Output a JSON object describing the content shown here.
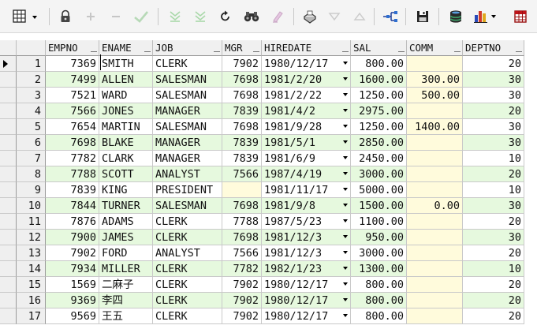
{
  "columns": [
    "EMPNO",
    "ENAME",
    "JOB",
    "MGR",
    "HIREDATE",
    "SAL",
    "COMM",
    "DEPTNO"
  ],
  "rows": [
    {
      "num": "1",
      "empno": "7369",
      "ename": "SMITH",
      "job": "CLERK",
      "mgr": "7902",
      "hiredate": "1980/12/17",
      "sal": "800.00",
      "comm": "",
      "deptno": "20"
    },
    {
      "num": "2",
      "empno": "7499",
      "ename": "ALLEN",
      "job": "SALESMAN",
      "mgr": "7698",
      "hiredate": "1981/2/20",
      "sal": "1600.00",
      "comm": "300.00",
      "deptno": "30"
    },
    {
      "num": "3",
      "empno": "7521",
      "ename": "WARD",
      "job": "SALESMAN",
      "mgr": "7698",
      "hiredate": "1981/2/22",
      "sal": "1250.00",
      "comm": "500.00",
      "deptno": "30"
    },
    {
      "num": "4",
      "empno": "7566",
      "ename": "JONES",
      "job": "MANAGER",
      "mgr": "7839",
      "hiredate": "1981/4/2",
      "sal": "2975.00",
      "comm": "",
      "deptno": "20"
    },
    {
      "num": "5",
      "empno": "7654",
      "ename": "MARTIN",
      "job": "SALESMAN",
      "mgr": "7698",
      "hiredate": "1981/9/28",
      "sal": "1250.00",
      "comm": "1400.00",
      "deptno": "30"
    },
    {
      "num": "6",
      "empno": "7698",
      "ename": "BLAKE",
      "job": "MANAGER",
      "mgr": "7839",
      "hiredate": "1981/5/1",
      "sal": "2850.00",
      "comm": "",
      "deptno": "30"
    },
    {
      "num": "7",
      "empno": "7782",
      "ename": "CLARK",
      "job": "MANAGER",
      "mgr": "7839",
      "hiredate": "1981/6/9",
      "sal": "2450.00",
      "comm": "",
      "deptno": "10"
    },
    {
      "num": "8",
      "empno": "7788",
      "ename": "SCOTT",
      "job": "ANALYST",
      "mgr": "7566",
      "hiredate": "1987/4/19",
      "sal": "3000.00",
      "comm": "",
      "deptno": "20"
    },
    {
      "num": "9",
      "empno": "7839",
      "ename": "KING",
      "job": "PRESIDENT",
      "mgr": "",
      "hiredate": "1981/11/17",
      "sal": "5000.00",
      "comm": "",
      "deptno": "10"
    },
    {
      "num": "10",
      "empno": "7844",
      "ename": "TURNER",
      "job": "SALESMAN",
      "mgr": "7698",
      "hiredate": "1981/9/8",
      "sal": "1500.00",
      "comm": "0.00",
      "deptno": "30"
    },
    {
      "num": "11",
      "empno": "7876",
      "ename": "ADAMS",
      "job": "CLERK",
      "mgr": "7788",
      "hiredate": "1987/5/23",
      "sal": "1100.00",
      "comm": "",
      "deptno": "20"
    },
    {
      "num": "12",
      "empno": "7900",
      "ename": "JAMES",
      "job": "CLERK",
      "mgr": "7698",
      "hiredate": "1981/12/3",
      "sal": "950.00",
      "comm": "",
      "deptno": "30"
    },
    {
      "num": "13",
      "empno": "7902",
      "ename": "FORD",
      "job": "ANALYST",
      "mgr": "7566",
      "hiredate": "1981/12/3",
      "sal": "3000.00",
      "comm": "",
      "deptno": "20"
    },
    {
      "num": "14",
      "empno": "7934",
      "ename": "MILLER",
      "job": "CLERK",
      "mgr": "7782",
      "hiredate": "1982/1/23",
      "sal": "1300.00",
      "comm": "",
      "deptno": "10"
    },
    {
      "num": "15",
      "empno": "1569",
      "ename": "二麻子",
      "job": "CLERK",
      "mgr": "7902",
      "hiredate": "1980/12/17",
      "sal": "800.00",
      "comm": "",
      "deptno": "20"
    },
    {
      "num": "16",
      "empno": "9369",
      "ename": "李四",
      "job": "CLERK",
      "mgr": "7902",
      "hiredate": "1980/12/17",
      "sal": "800.00",
      "comm": "",
      "deptno": "20"
    },
    {
      "num": "17",
      "empno": "9569",
      "ename": "王五",
      "job": "CLERK",
      "mgr": "7902",
      "hiredate": "1980/12/17",
      "sal": "800.00",
      "comm": "",
      "deptno": "20"
    }
  ],
  "toolbar_icons": [
    "grid-select-icon",
    "lock-icon",
    "add-record-icon",
    "remove-record-icon",
    "post-changes-icon",
    "query-by-example-icon",
    "execute-query-icon",
    "refresh-icon",
    "find-icon",
    "clear-icon",
    "print-icon",
    "first-record-icon",
    "last-record-icon",
    "tree-view-icon",
    "save-icon",
    "database-icon",
    "chart-icon",
    "table-icon"
  ],
  "colors": {
    "even_row": "#e6f9de",
    "null_cell": "#fffbdc",
    "header": "#f0f0f0"
  }
}
